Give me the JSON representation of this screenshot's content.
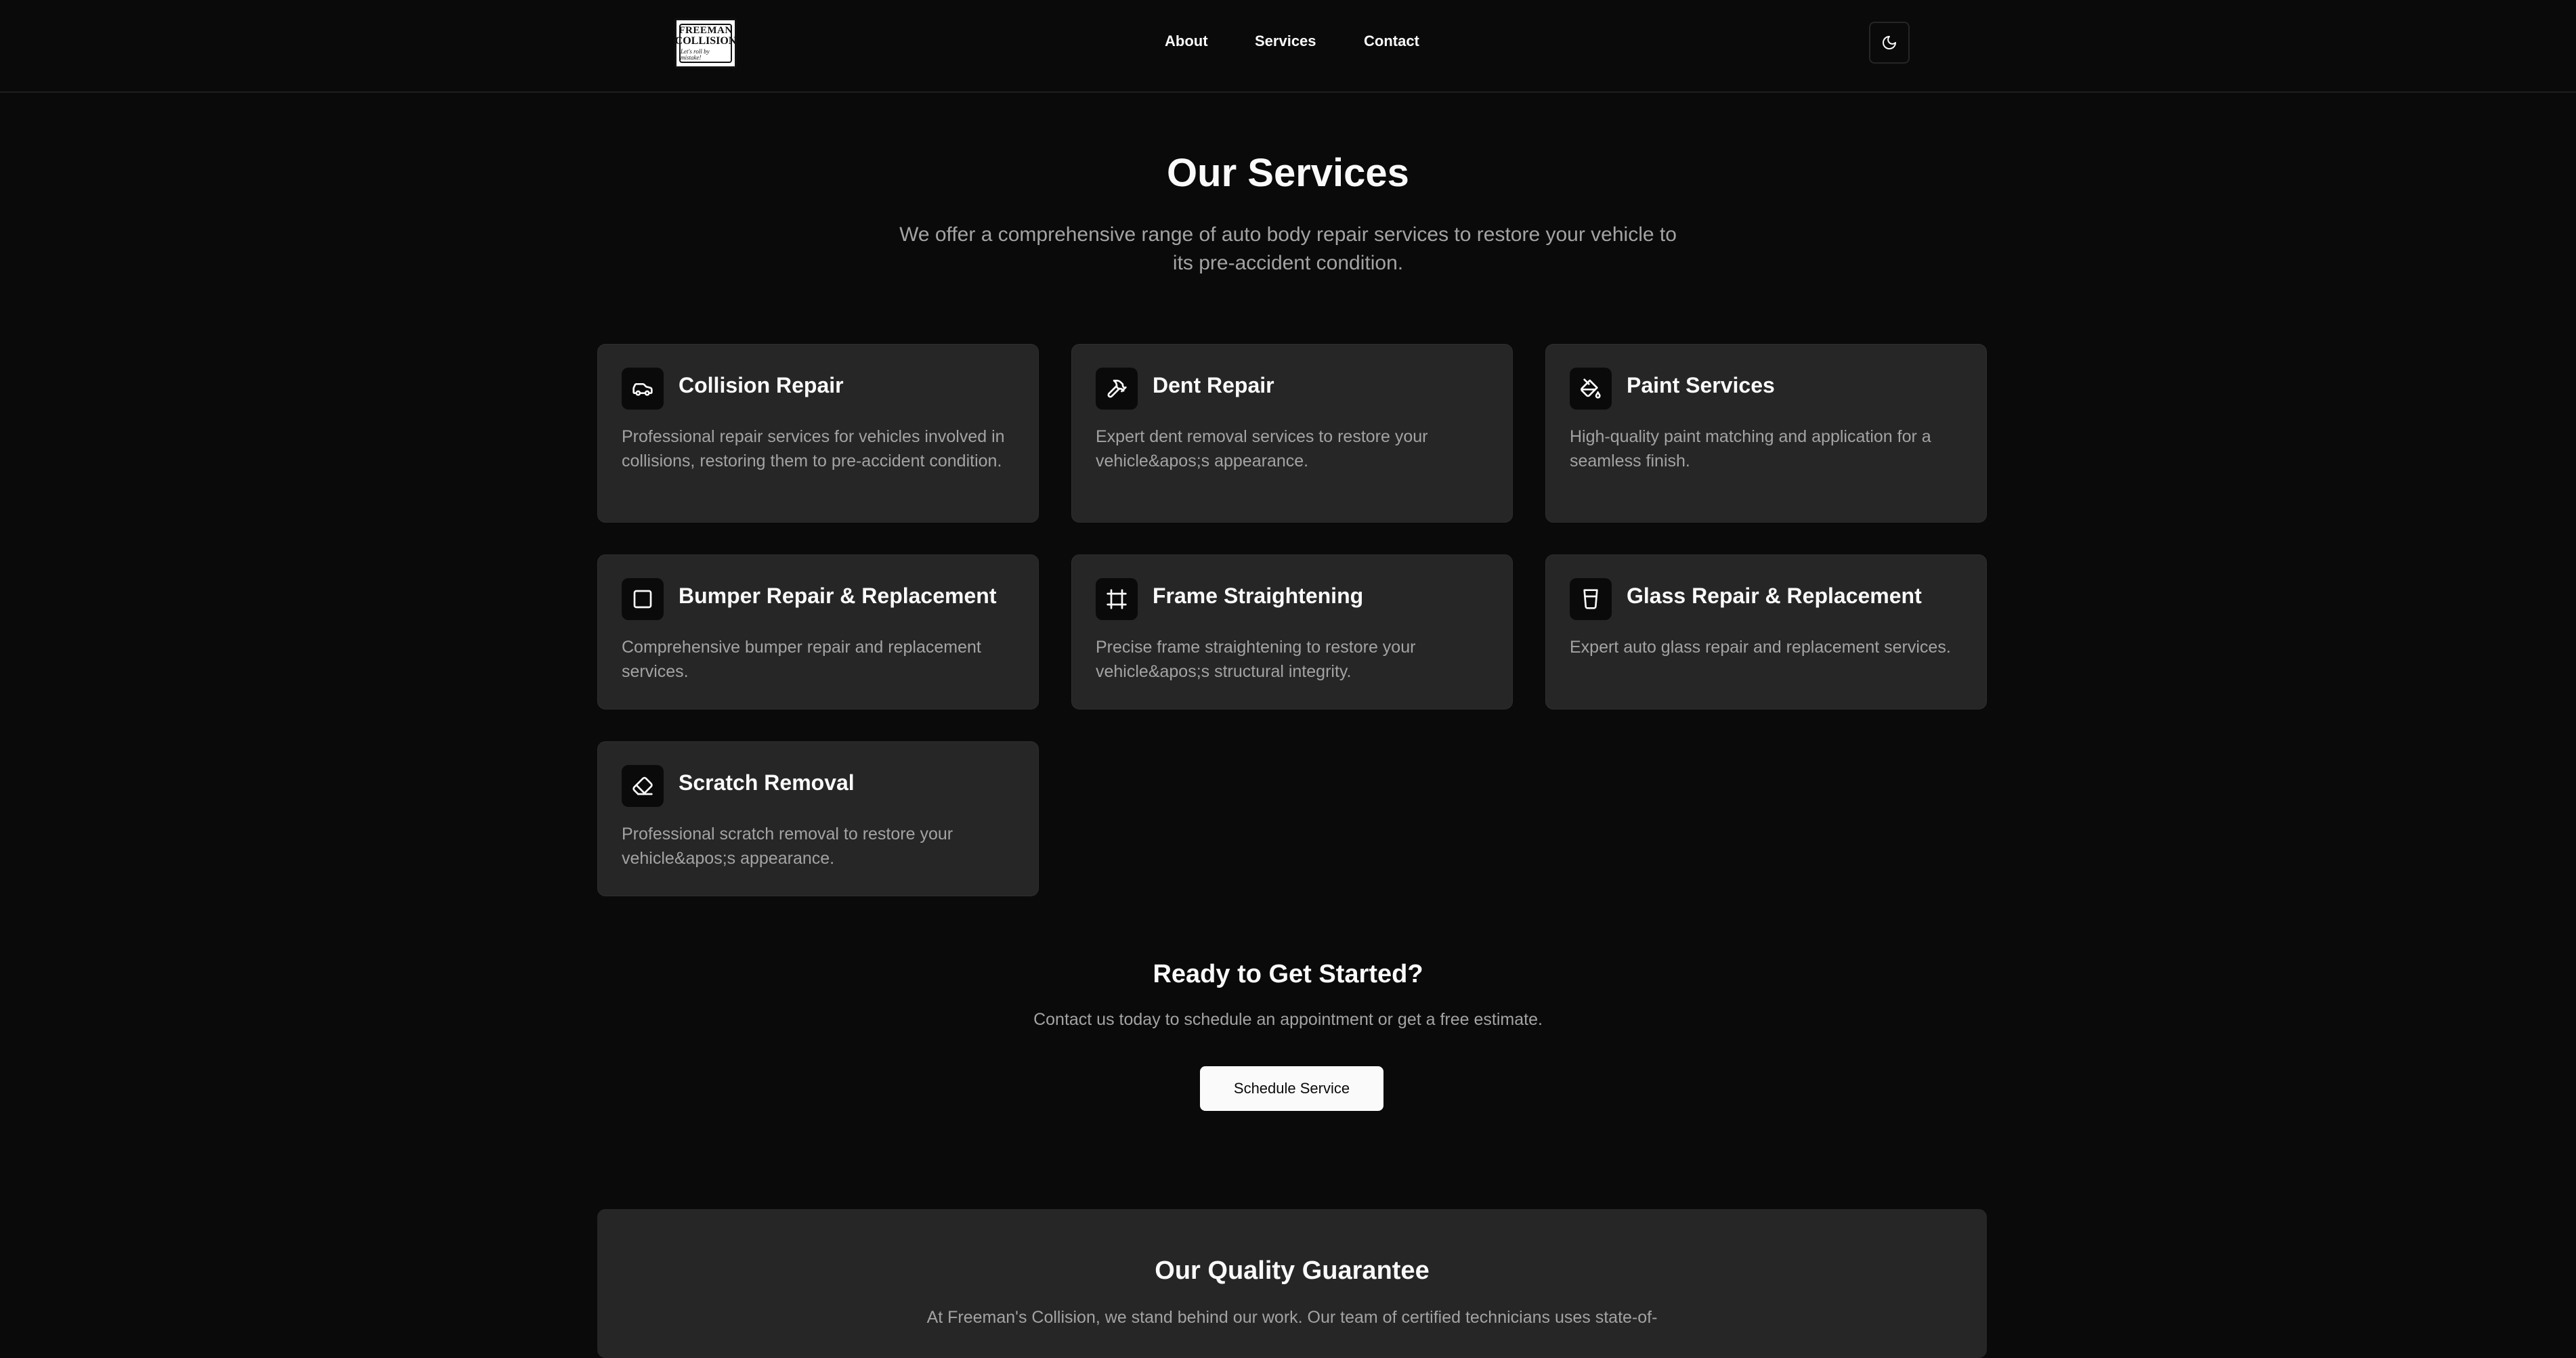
{
  "header": {
    "logo": {
      "line1": "FREEMAN",
      "line2": "COLLISION",
      "tagline": "Let's roll by mistake!"
    },
    "nav": [
      {
        "label": "About"
      },
      {
        "label": "Services"
      },
      {
        "label": "Contact"
      }
    ],
    "theme_toggle_icon": "moon-icon"
  },
  "hero": {
    "title": "Our Services",
    "subtitle": "We offer a comprehensive range of auto body repair services to restore your vehicle to its pre-accident condition."
  },
  "services": [
    {
      "icon": "car-icon",
      "title": "Collision Repair",
      "description": "Professional repair services for vehicles involved in collisions, restoring them to pre-accident condition."
    },
    {
      "icon": "hammer-icon",
      "title": "Dent Repair",
      "description": "Expert dent removal services to restore your vehicle&apos;s appearance."
    },
    {
      "icon": "paint-bucket-icon",
      "title": "Paint Services",
      "description": "High-quality paint matching and application for a seamless finish."
    },
    {
      "icon": "square-icon",
      "title": "Bumper Repair & Replacement",
      "description": "Comprehensive bumper repair and replacement services."
    },
    {
      "icon": "frame-icon",
      "title": "Frame Straightening",
      "description": "Precise frame straightening to restore your vehicle&apos;s structural integrity."
    },
    {
      "icon": "glass-icon",
      "title": "Glass Repair & Replacement",
      "description": "Expert auto glass repair and replacement services."
    },
    {
      "icon": "eraser-icon",
      "title": "Scratch Removal",
      "description": "Professional scratch removal to restore your vehicle&apos;s appearance."
    }
  ],
  "cta": {
    "title": "Ready to Get Started?",
    "text": "Contact us today to schedule an appointment or get a free estimate.",
    "button_label": "Schedule Service"
  },
  "guarantee": {
    "title": "Our Quality Guarantee",
    "text": "At Freeman's Collision, we stand behind our work. Our team of certified technicians uses state-of-"
  },
  "colors": {
    "background": "#0a0a0a",
    "card": "#262626",
    "text": "#fafafa",
    "muted_text": "#a3a3a3"
  }
}
